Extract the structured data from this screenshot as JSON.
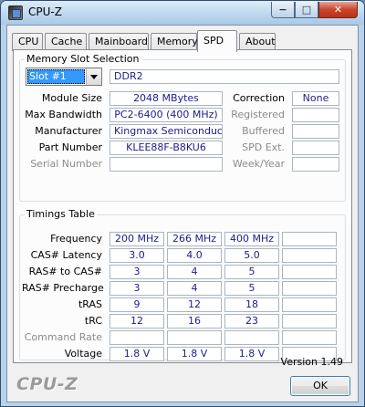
{
  "window": {
    "title": "CPU-Z",
    "minimize": "−",
    "maximize": "□",
    "close": "✕"
  },
  "tabs": [
    {
      "label": "CPU"
    },
    {
      "label": "Cache"
    },
    {
      "label": "Mainboard"
    },
    {
      "label": "Memory"
    },
    {
      "label": "SPD",
      "active": true
    },
    {
      "label": "About"
    }
  ],
  "slot_section": {
    "title": "Memory Slot Selection",
    "slot_value": "Slot #1",
    "memory_type": "DDR2",
    "labels": {
      "module_size": "Module Size",
      "max_bandwidth": "Max Bandwidth",
      "manufacturer": "Manufacturer",
      "part_number": "Part Number",
      "serial_number": "Serial Number",
      "correction": "Correction",
      "registered": "Registered",
      "buffered": "Buffered",
      "spd_ext": "SPD Ext.",
      "week_year": "Week/Year"
    },
    "values": {
      "module_size": "2048 MBytes",
      "max_bandwidth": "PC2-6400 (400 MHz)",
      "manufacturer": "Kingmax Semiconductor",
      "part_number": "KLEE88F-B8KU6",
      "serial_number": "",
      "correction": "None",
      "registered": "",
      "buffered": "",
      "spd_ext": "",
      "week_year": ""
    }
  },
  "timings": {
    "title": "Timings Table",
    "rows": [
      {
        "label": "Frequency",
        "dim": false,
        "values": [
          "200 MHz",
          "266 MHz",
          "400 MHz",
          ""
        ]
      },
      {
        "label": "CAS# Latency",
        "dim": false,
        "values": [
          "3.0",
          "4.0",
          "5.0",
          ""
        ]
      },
      {
        "label": "RAS# to CAS#",
        "dim": false,
        "values": [
          "3",
          "4",
          "5",
          ""
        ]
      },
      {
        "label": "RAS# Precharge",
        "dim": false,
        "values": [
          "3",
          "4",
          "5",
          ""
        ]
      },
      {
        "label": "tRAS",
        "dim": false,
        "values": [
          "9",
          "12",
          "18",
          ""
        ]
      },
      {
        "label": "tRC",
        "dim": false,
        "values": [
          "12",
          "16",
          "23",
          ""
        ]
      },
      {
        "label": "Command Rate",
        "dim": true,
        "values": [
          "",
          "",
          "",
          ""
        ]
      },
      {
        "label": "Voltage",
        "dim": false,
        "values": [
          "1.8 V",
          "1.8 V",
          "1.8 V",
          ""
        ]
      }
    ]
  },
  "footer": {
    "version": "Version 1.49",
    "brand": "CPU-Z",
    "ok_label": "OK"
  }
}
